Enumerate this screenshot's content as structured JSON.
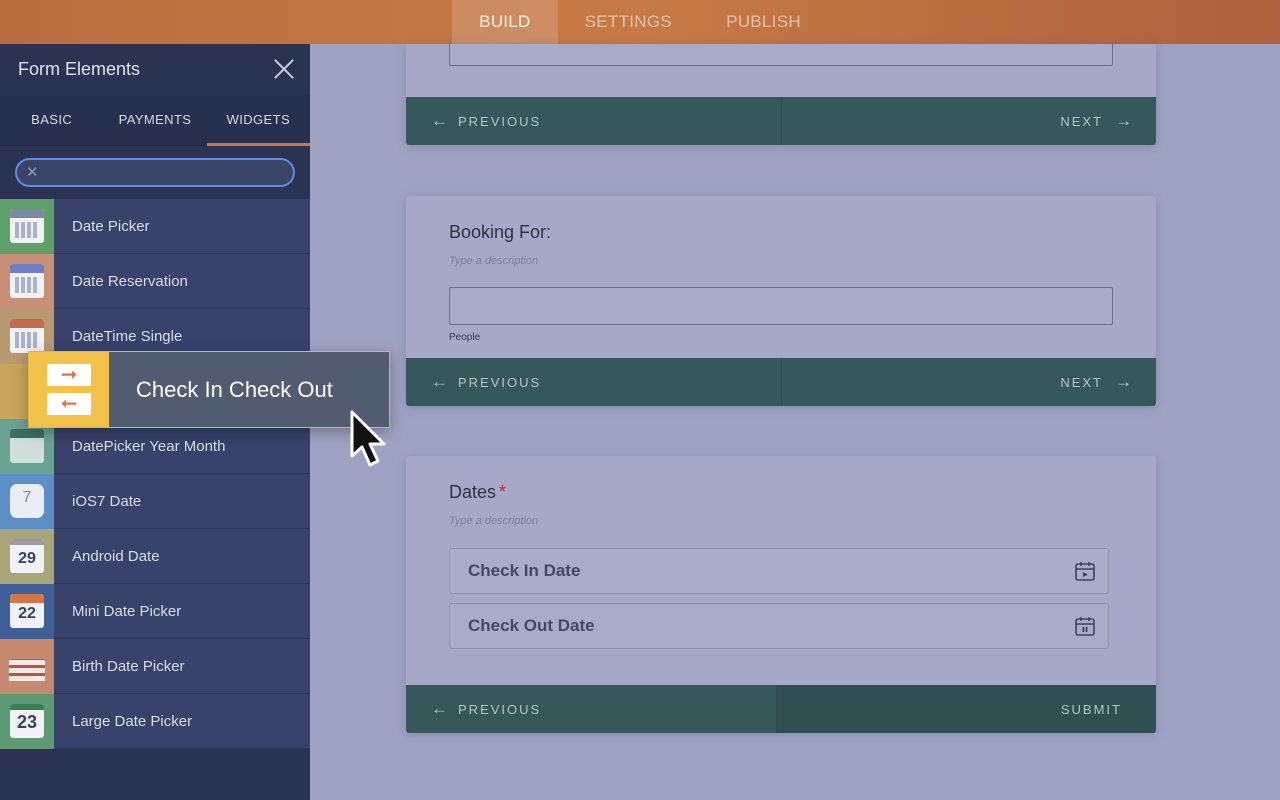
{
  "topbar": {
    "tabs": [
      {
        "label": "BUILD"
      },
      {
        "label": "SETTINGS"
      },
      {
        "label": "PUBLISH"
      }
    ]
  },
  "sidebar": {
    "title": "Form Elements",
    "tabs": [
      {
        "label": "BASIC"
      },
      {
        "label": "PAYMENTS"
      },
      {
        "label": "WIDGETS"
      }
    ],
    "search": {
      "value": ""
    },
    "items": [
      {
        "label": "Date Picker"
      },
      {
        "label": "Date Reservation"
      },
      {
        "label": "DateTime Single"
      },
      {
        "label": ""
      },
      {
        "label": "DatePicker Year Month"
      },
      {
        "label": "iOS7 Date"
      },
      {
        "label": "Android Date"
      },
      {
        "label": "Mini Date Picker"
      },
      {
        "label": "Birth Date Picker"
      },
      {
        "label": "Large Date Picker"
      }
    ]
  },
  "drag_ghost": {
    "label": "Check In Check Out"
  },
  "form": {
    "card1": {
      "prev": "PREVIOUS",
      "next": "NEXT"
    },
    "card2": {
      "label": "Booking For:",
      "description": "Type a description",
      "sublabel": "People",
      "prev": "PREVIOUS",
      "next": "NEXT"
    },
    "card3": {
      "label": "Dates",
      "required_mark": "*",
      "description": "Type a description",
      "checkin": "Check In Date",
      "checkout": "Check Out Date",
      "prev": "PREVIOUS",
      "submit": "SUBMIT"
    }
  },
  "icons": {
    "close": "close-icon",
    "search_clear": "clear-icon",
    "arrow_left": "arrow-left-icon",
    "arrow_right": "arrow-right-icon",
    "calendar": "calendar-icon",
    "cursor": "mouse-pointer-icon"
  },
  "colors": {
    "topbar": "#c77a45",
    "sidebar": "#2b3353",
    "accent": "#c9734b",
    "footer": "#37585a",
    "ghost_icon": "#f2c24a"
  }
}
